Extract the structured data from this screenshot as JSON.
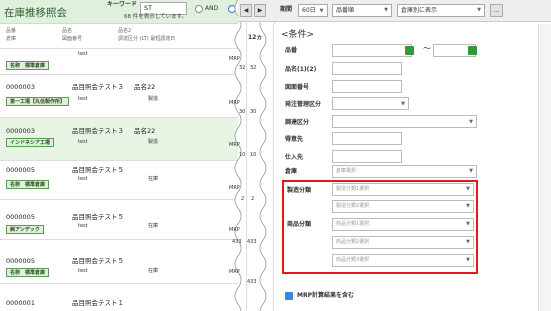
{
  "header": {
    "title": "在庫推移照会",
    "keyword_label": "キーワード",
    "keyword_value": "ST",
    "and_label": "AND",
    "count_text": "68 件を表示しています。"
  },
  "list_header": {
    "col1_line1": "品番",
    "col1_line2": "倉庫",
    "col2_line1": "品名",
    "col2_line2": "図面番号",
    "col3_line1": "品名2",
    "col3_line2": "調達区分 (LT) 最短調達日"
  },
  "rows": [
    {
      "code": "",
      "name": "",
      "name2": "",
      "drawing": "test",
      "procurement": "",
      "badge": "名称　標準倉庫"
    },
    {
      "code": "0000003",
      "name": "品目照会テスト３",
      "name2": "品名22",
      "drawing": "test",
      "procurement": "製造",
      "badge": "第一工場【丸信製作所】"
    },
    {
      "code": "0000003",
      "name": "品目照会テスト３",
      "name2": "品名22",
      "drawing": "test",
      "procurement": "製造",
      "badge": "インドネシア工場"
    },
    {
      "code": "0000005",
      "name": "品目照会テスト５",
      "name2": "",
      "drawing": "test",
      "procurement": "在庫",
      "badge": "名称　標準倉庫"
    },
    {
      "code": "0000005",
      "name": "品目照会テスト５",
      "name2": "",
      "drawing": "test",
      "procurement": "在庫",
      "badge": "㈱アンデック"
    },
    {
      "code": "0000005",
      "name": "品目照会テスト５",
      "name2": "",
      "drawing": "test",
      "procurement": "在庫",
      "badge": "名称　標準倉庫"
    },
    {
      "code": "0000001",
      "name": "品目照会テスト１",
      "name2": "",
      "drawing": "",
      "procurement": "",
      "badge": ""
    }
  ],
  "middle": {
    "month_header": "12ヵ",
    "mrp_label": "MRP",
    "values": [
      "32",
      "32",
      "30",
      "30",
      "10",
      "10",
      "2",
      "2",
      "433",
      "433",
      "433"
    ]
  },
  "toolbar": {
    "prev": "◀",
    "next": "▶",
    "period_label": "期間",
    "period_value": "60日",
    "sort_value": "品番順",
    "display_value": "倉庫別に表示",
    "more": "..."
  },
  "conditions": {
    "title": "<条件>",
    "range_sep": "〜",
    "item_code": "品番",
    "item_name": "品名(1)(2)",
    "drawing_no": "図面番号",
    "order_mgmt": "発注管理区分",
    "procurement": "調達区分",
    "supplier": "得意先",
    "vendor": "仕入先",
    "warehouse": "倉庫",
    "warehouse_placeholder": "倉庫選択",
    "mfg_class_label": "製造分類",
    "mfg_class_1": "製造分類1選択",
    "mfg_class_2": "製造分類2選択",
    "product_class_label": "商品分類",
    "product_class_1": "商品分類1選択",
    "product_class_2": "商品分類2選択",
    "product_class_3": "商品分類3選択",
    "mrp_include": "MRP計算結果を含む"
  },
  "colors": {
    "accent": "#2e9a3a",
    "highlight": "#e0191b",
    "title_bg": "#dff1dc"
  }
}
